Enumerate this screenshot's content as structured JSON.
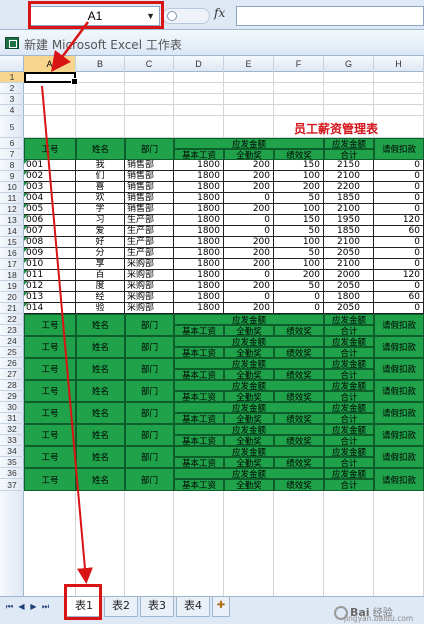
{
  "formula_bar": {
    "name_box": "A1",
    "fx_label": "fx",
    "formula": ""
  },
  "window": {
    "title": "新建 Microsoft Excel 工作表"
  },
  "columns": [
    "A",
    "B",
    "C",
    "D",
    "E",
    "F",
    "G",
    "H"
  ],
  "rows": [
    "1",
    "2",
    "3",
    "4",
    "5",
    "6",
    "7",
    "8",
    "9",
    "10",
    "11",
    "12",
    "13",
    "14",
    "15",
    "16",
    "17",
    "18",
    "19",
    "20",
    "21",
    "22",
    "23",
    "24",
    "25",
    "26",
    "27",
    "28",
    "29",
    "30",
    "31",
    "32",
    "33",
    "34",
    "35",
    "36",
    "37"
  ],
  "sheet": {
    "title": "员工薪资管理表",
    "header": {
      "id": "工号",
      "name": "姓名",
      "dept": "部门",
      "payable": "应发金额",
      "base": "基本工资",
      "allowance": "全勤奖",
      "bonus": "绩效奖",
      "total_line1": "应发金额",
      "total_line2": "合计",
      "deduct": "请假扣款"
    },
    "records": [
      {
        "id": "001",
        "name": "我",
        "dept": "销售部",
        "base": "1800",
        "allowance": "200",
        "bonus": "150",
        "total": "2150",
        "deduct": "0"
      },
      {
        "id": "002",
        "name": "们",
        "dept": "销售部",
        "base": "1800",
        "allowance": "200",
        "bonus": "100",
        "total": "2100",
        "deduct": "0"
      },
      {
        "id": "003",
        "name": "喜",
        "dept": "销售部",
        "base": "1800",
        "allowance": "200",
        "bonus": "200",
        "total": "2200",
        "deduct": "0"
      },
      {
        "id": "004",
        "name": "欢",
        "dept": "销售部",
        "base": "1800",
        "allowance": "0",
        "bonus": "50",
        "total": "1850",
        "deduct": "0"
      },
      {
        "id": "005",
        "name": "学",
        "dept": "销售部",
        "base": "1800",
        "allowance": "200",
        "bonus": "100",
        "total": "2100",
        "deduct": "0"
      },
      {
        "id": "006",
        "name": "习",
        "dept": "生产部",
        "base": "1800",
        "allowance": "0",
        "bonus": "150",
        "total": "1950",
        "deduct": "120"
      },
      {
        "id": "007",
        "name": "爱",
        "dept": "生产部",
        "base": "1800",
        "allowance": "0",
        "bonus": "50",
        "total": "1850",
        "deduct": "60"
      },
      {
        "id": "008",
        "name": "好",
        "dept": "生产部",
        "base": "1800",
        "allowance": "200",
        "bonus": "100",
        "total": "2100",
        "deduct": "0"
      },
      {
        "id": "009",
        "name": "分",
        "dept": "生产部",
        "base": "1800",
        "allowance": "200",
        "bonus": "50",
        "total": "2050",
        "deduct": "0"
      },
      {
        "id": "010",
        "name": "享",
        "dept": "采购部",
        "base": "1800",
        "allowance": "200",
        "bonus": "100",
        "total": "2100",
        "deduct": "0"
      },
      {
        "id": "011",
        "name": "百",
        "dept": "采购部",
        "base": "1800",
        "allowance": "0",
        "bonus": "200",
        "total": "2000",
        "deduct": "120"
      },
      {
        "id": "012",
        "name": "度",
        "dept": "采购部",
        "base": "1800",
        "allowance": "200",
        "bonus": "50",
        "total": "2050",
        "deduct": "0"
      },
      {
        "id": "013",
        "name": "经",
        "dept": "采购部",
        "base": "1800",
        "allowance": "0",
        "bonus": "0",
        "total": "1800",
        "deduct": "60"
      },
      {
        "id": "014",
        "name": "验",
        "dept": "采购部",
        "base": "1800",
        "allowance": "200",
        "bonus": "0",
        "total": "2050",
        "deduct": "0"
      }
    ]
  },
  "tabs": {
    "items": [
      "表1",
      "表2",
      "表3",
      "表4"
    ],
    "active": 0
  },
  "watermark": {
    "brand": "Bai",
    "text": "经验",
    "url": "jingyan.baidu.com"
  },
  "colors": {
    "header_green": "#1fa24a",
    "title_red": "#d3151b",
    "annotation_red": "#d81414",
    "selection": "#f8d58c"
  }
}
